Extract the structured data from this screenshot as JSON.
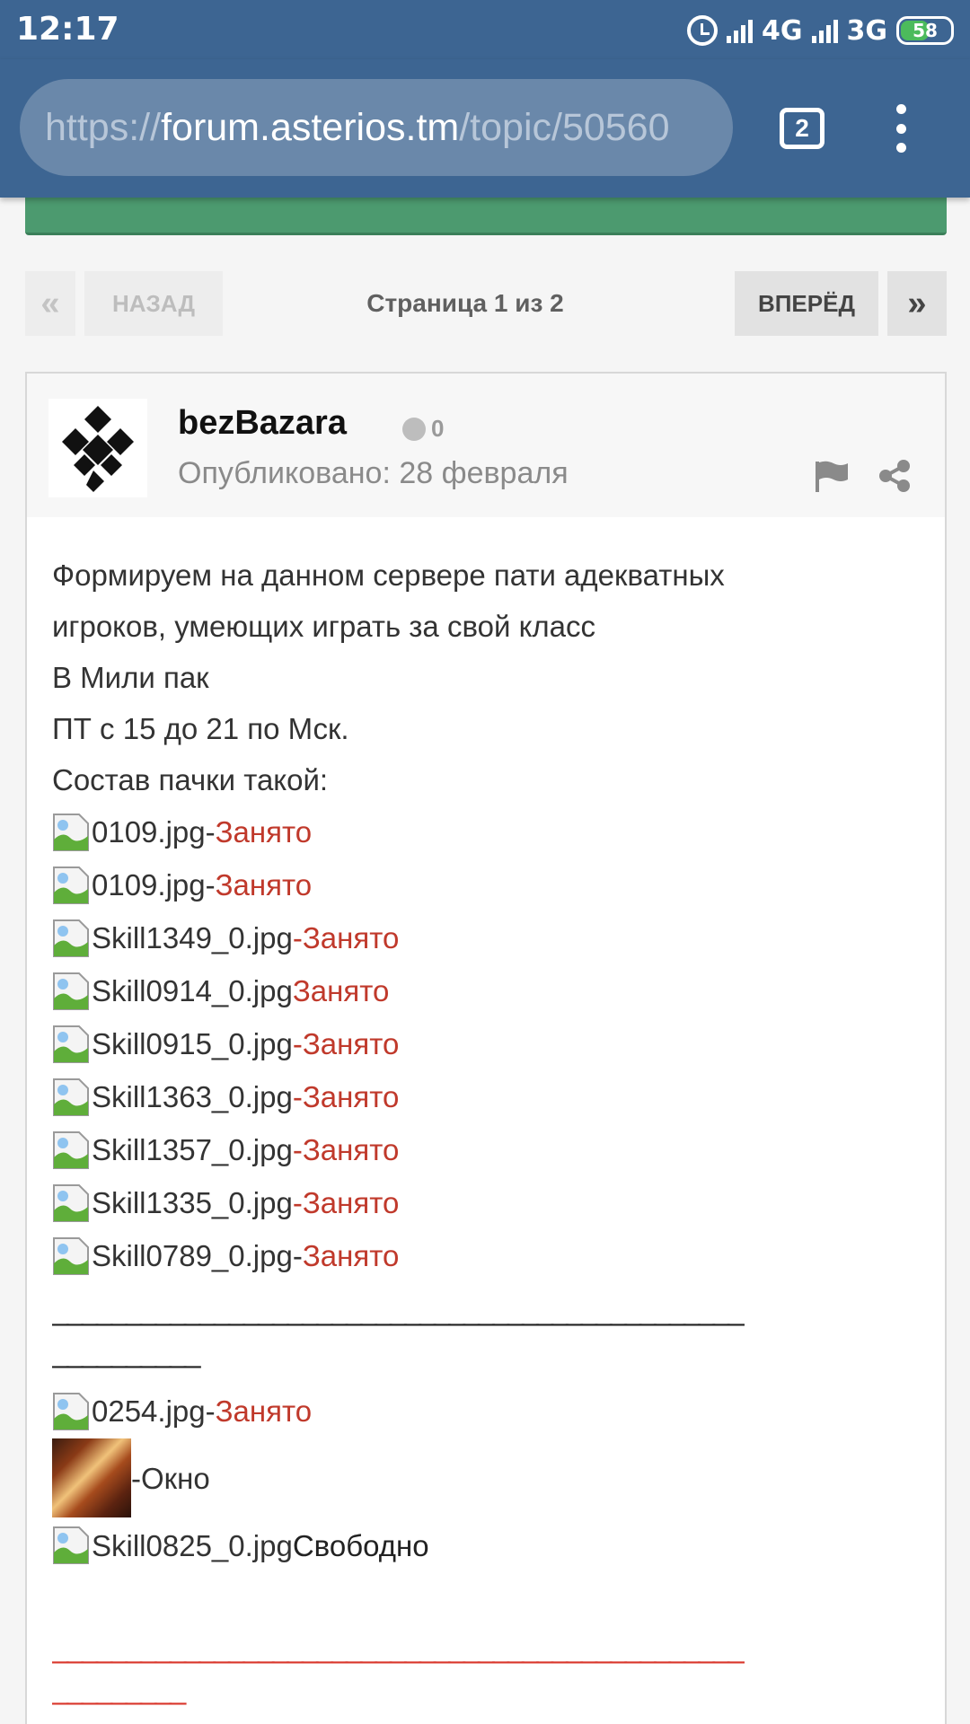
{
  "status_bar": {
    "time": "12:17",
    "network_1": "4G",
    "network_2": "3G",
    "battery": "58",
    "battery_level": 0.58
  },
  "browser": {
    "url_scheme": "https://",
    "url_host": "forum.asterios.tm",
    "url_path": "/topic/50560",
    "tab_count": "2"
  },
  "pagination": {
    "first_icon": "«",
    "prev_label": "НАЗАД",
    "page_info": "Страница 1 из 2",
    "next_label": "ВПЕРЁД",
    "last_icon": "»"
  },
  "post": {
    "author": "bezBazara",
    "reputation": "0",
    "date": "Опубликовано: 28 февраля",
    "intro_lines": [
      "Формируем на данном сервере пати адекватных",
      "игроков, умеющих играть за свой класс",
      "В Мили пак",
      "ПТ с 15 до 21 по Мск.",
      "Состав пачки такой:"
    ],
    "party": [
      {
        "file": "0109.jpg-",
        "status": " Занято"
      },
      {
        "file": "0109.jpg-",
        "status": " Занято"
      },
      {
        "file": "Skill1349_0.jpg",
        "status": "-Занято"
      },
      {
        "file": "Skill0914_0.jpg",
        "status": "Занято"
      },
      {
        "file": "Skill0915_0.jpg",
        "status": "-Занято"
      },
      {
        "file": "Skill1363_0.jpg",
        "status": "-Занято"
      },
      {
        "file": "Skill1357_0.jpg",
        "status": "-Занято"
      },
      {
        "file": "Skill1335_0.jpg",
        "status": "-Занято"
      },
      {
        "file": "Skill0789_0.jpg-",
        "status": " Занято"
      }
    ],
    "separator_1": "_______________________________________________",
    "separator_2": "__________",
    "extra": {
      "file": "0254.jpg-",
      "status": " Занято",
      "window_label": "-Окно",
      "free_file": "Skill0825_0.jpg",
      "free_status": "Свободно"
    },
    "separator_red_1": "_______________________________________________",
    "separator_red_2": "_________"
  }
}
